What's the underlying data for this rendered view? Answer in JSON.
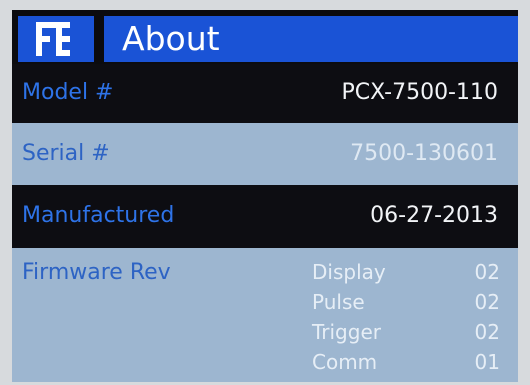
{
  "title_bar": {
    "title": "About",
    "logo_icon": "brand-logo-icon",
    "accent_color": "#1a53d6"
  },
  "rows": {
    "model": {
      "label": "Model #",
      "value": "PCX-7500-110"
    },
    "serial": {
      "label": "Serial #",
      "value": "7500-130601"
    },
    "manufactured": {
      "label": "Manufactured",
      "value": "06-27-2013"
    },
    "firmware": {
      "label": "Firmware Rev",
      "items": [
        {
          "name": "Display",
          "version": "02"
        },
        {
          "name": "Pulse",
          "version": "02"
        },
        {
          "name": "Trigger",
          "version": "02"
        },
        {
          "name": "Comm",
          "version": "01"
        }
      ]
    }
  }
}
